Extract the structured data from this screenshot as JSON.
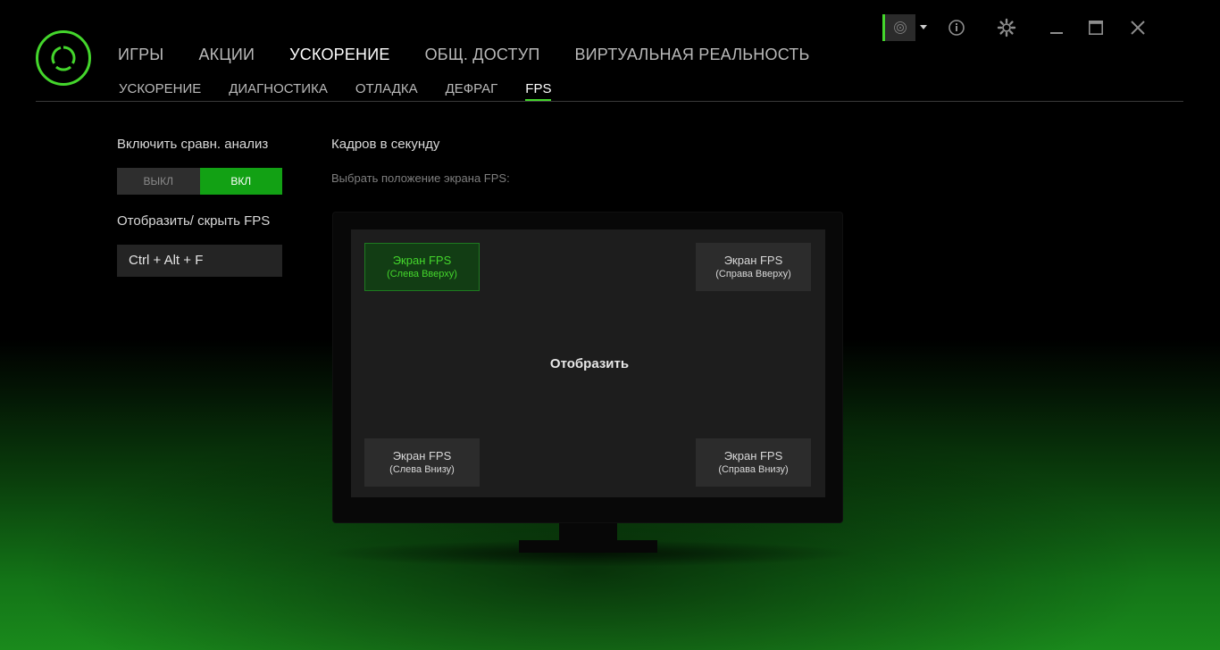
{
  "window": {
    "controls": {
      "profile_avatar_icon": "fingerprint-avatar-icon",
      "profile_dropdown_icon": "caret-down-icon",
      "info_icon": "info-icon",
      "settings_icon": "gear-icon",
      "minimize_icon": "minimize-icon",
      "maximize_icon": "maximize-icon",
      "close_icon": "close-icon"
    }
  },
  "logo": {
    "icon": "razer-cortex-logo-icon",
    "accent": "#44d62c"
  },
  "main_nav": [
    {
      "label": "ИГРЫ",
      "active": false
    },
    {
      "label": "АКЦИИ",
      "active": false
    },
    {
      "label": "УСКОРЕНИЕ",
      "active": true
    },
    {
      "label": "ОБЩ. ДОСТУП",
      "active": false
    },
    {
      "label": "ВИРТУАЛЬНАЯ РЕАЛЬНОСТЬ",
      "active": false
    }
  ],
  "sub_nav": [
    {
      "label": "УСКОРЕНИЕ",
      "active": false
    },
    {
      "label": "ДИАГНОСТИКА",
      "active": false
    },
    {
      "label": "ОТЛАДКА",
      "active": false
    },
    {
      "label": "ДЕФРАГ",
      "active": false
    },
    {
      "label": "FPS",
      "active": true
    }
  ],
  "benchmark": {
    "label": "Включить сравн. анализ",
    "off_label": "ВЫКЛ",
    "on_label": "ВКЛ",
    "state": "on"
  },
  "hotkey": {
    "label": "Отобразить/ скрыть FPS",
    "value": "Ctrl + Alt + F"
  },
  "fps": {
    "heading": "Кадров в секунду",
    "subheading": "Выбрать положение экрана FPS:",
    "display_label": "Отобразить",
    "positions": {
      "top_left": {
        "line1": "Экран FPS",
        "line2": "(Слева Вверху)",
        "selected": true
      },
      "top_right": {
        "line1": "Экран FPS",
        "line2": "(Справа Вверху)",
        "selected": false
      },
      "bottom_left": {
        "line1": "Экран FPS",
        "line2": "(Слева Внизу)",
        "selected": false
      },
      "bottom_right": {
        "line1": "Экран FPS",
        "line2": "(Справа Внизу)",
        "selected": false
      }
    }
  },
  "colors": {
    "accent_green": "#44d62c",
    "toggle_on": "#12a114",
    "selected_bg": "#123d14"
  }
}
